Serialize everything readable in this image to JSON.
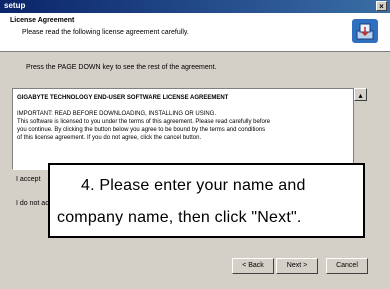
{
  "window": {
    "title": "setup",
    "close_glyph": "×"
  },
  "header": {
    "title": "License Agreement",
    "subtitle": "Please read the following license agreement carefully.",
    "icon": "installer-icon"
  },
  "instruction": "Press the PAGE DOWN key to see the rest of the agreement.",
  "license": {
    "lines": [
      "GIGABYTE TECHNOLOGY END-USER SOFTWARE LICENSE AGREEMENT",
      "IMPORTANT: READ BEFORE DOWNLOADING, INSTALLING OR USING.",
      "This software is licensed to you under the terms of this agreement. Please read carefully before",
      "you continue. By clicking the button below you agree to be bound by the terms and conditions",
      "of this license agreement. If you do not agree, click the cancel button."
    ]
  },
  "radios": [
    {
      "label": "I accept"
    },
    {
      "label": "I do not accept"
    }
  ],
  "buttons": {
    "back": "< Back",
    "next": "Next >",
    "cancel": "Cancel"
  },
  "callout": {
    "line1": "4. Please enter your name and",
    "line2": "company  name, then click \"Next\"."
  }
}
